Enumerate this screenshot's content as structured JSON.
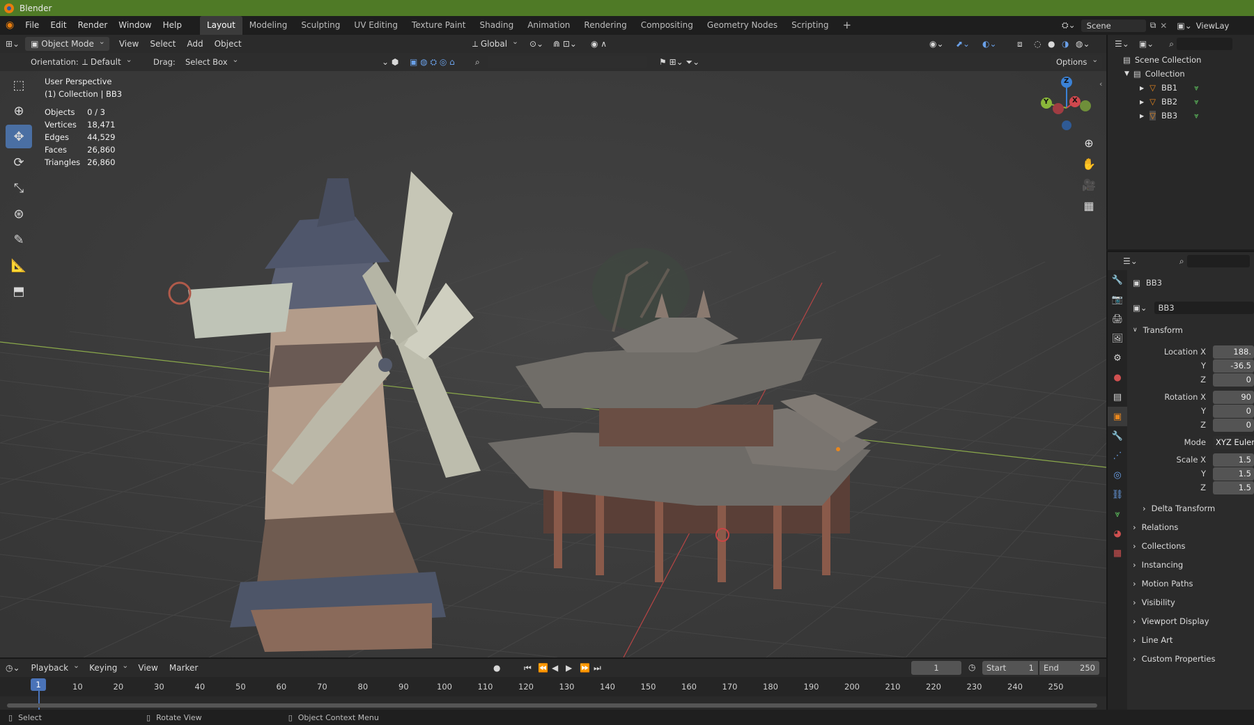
{
  "app": {
    "title": "Blender"
  },
  "menu": {
    "items": [
      "File",
      "Edit",
      "Render",
      "Window",
      "Help"
    ]
  },
  "workspaces": [
    "Layout",
    "Modeling",
    "Sculpting",
    "UV Editing",
    "Texture Paint",
    "Shading",
    "Animation",
    "Rendering",
    "Compositing",
    "Geometry Nodes",
    "Scripting"
  ],
  "workspace_add": "+",
  "scene": {
    "label": "Scene",
    "viewlayer": "ViewLay"
  },
  "viewport_header": {
    "mode": "Object Mode",
    "menus": [
      "View",
      "Select",
      "Add",
      "Object"
    ],
    "transform_orientation": "Global",
    "options": "Options"
  },
  "tool_settings": {
    "orientation_label": "Orientation:",
    "orientation_value": "Default",
    "drag_label": "Drag:",
    "drag_value": "Select Box"
  },
  "overlay_info": {
    "view_name": "User Perspective",
    "collection_line": "(1) Collection | BB3",
    "stats": [
      {
        "label": "Objects",
        "value": "0 / 3"
      },
      {
        "label": "Vertices",
        "value": "18,471"
      },
      {
        "label": "Edges",
        "value": "44,529"
      },
      {
        "label": "Faces",
        "value": "26,860"
      },
      {
        "label": "Triangles",
        "value": "26,860"
      }
    ]
  },
  "gizmo_axes": {
    "x": "X",
    "y": "Y",
    "z": "Z"
  },
  "outliner": {
    "root": "Scene Collection",
    "collection": "Collection",
    "objects": [
      "BB1",
      "BB2",
      "BB3"
    ]
  },
  "properties": {
    "object_name": "BB3",
    "object_field": "BB3",
    "transform": {
      "header": "Transform",
      "location_label": "Location X",
      "location": [
        "188.",
        "-36.5",
        "0"
      ],
      "rotation_label": "Rotation X",
      "rotation": [
        "90",
        "0",
        "0"
      ],
      "mode_label": "Mode",
      "mode_value": "XYZ Euler",
      "scale_label": "Scale X",
      "scale": [
        "1.5",
        "1.5",
        "1.5"
      ],
      "axis_y": "Y",
      "axis_z": "Z"
    },
    "panels": [
      "Delta Transform",
      "Relations",
      "Collections",
      "Instancing",
      "Motion Paths",
      "Visibility",
      "Viewport Display",
      "Line Art",
      "Custom Properties"
    ]
  },
  "timeline": {
    "menus": [
      "Playback",
      "Keying",
      "View",
      "Marker"
    ],
    "current_frame": "1",
    "start_label": "Start",
    "start": "1",
    "end_label": "End",
    "end": "250",
    "frame_marker": "1",
    "ruler": [
      "10",
      "20",
      "30",
      "40",
      "50",
      "60",
      "70",
      "80",
      "90",
      "100",
      "110",
      "120",
      "130",
      "140",
      "150",
      "160",
      "170",
      "180",
      "190",
      "200",
      "210",
      "220",
      "230",
      "240",
      "250"
    ]
  },
  "statusbar": {
    "select": "Select",
    "rotate": "Rotate View",
    "context": "Object Context Menu"
  },
  "colors": {
    "titlebar": "#4f7a26",
    "active_tool": "#4a6fa3",
    "x_axis": "#d0484e",
    "y_axis": "#8ab73a",
    "z_axis": "#3b82d6",
    "frame_marker": "#4a73b8"
  }
}
